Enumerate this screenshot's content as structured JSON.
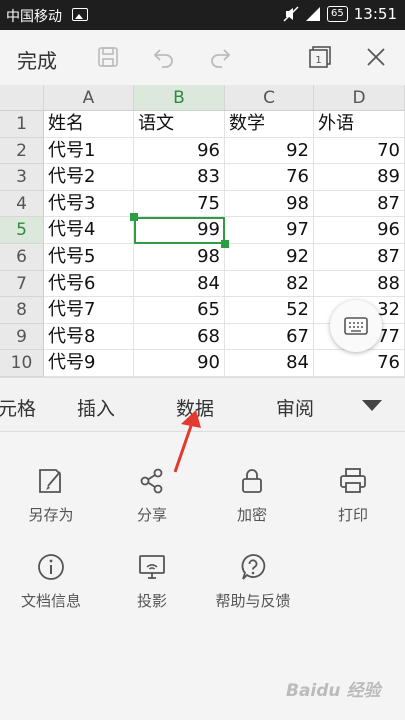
{
  "status": {
    "carrier": "中国移动",
    "battery": "65",
    "time": "13:51"
  },
  "toolbar": {
    "done": "完成"
  },
  "columns": [
    "A",
    "B",
    "C",
    "D"
  ],
  "rows": [
    "1",
    "2",
    "3",
    "4",
    "5",
    "6",
    "7",
    "8",
    "9",
    "10"
  ],
  "table": [
    [
      "姓名",
      "语文",
      "数学",
      "外语"
    ],
    [
      "代号1",
      "96",
      "92",
      "70"
    ],
    [
      "代号2",
      "83",
      "76",
      "89"
    ],
    [
      "代号3",
      "75",
      "98",
      "87"
    ],
    [
      "代号4",
      "99",
      "97",
      "96"
    ],
    [
      "代号5",
      "98",
      "92",
      "87"
    ],
    [
      "代号6",
      "84",
      "82",
      "88"
    ],
    [
      "代号7",
      "65",
      "52",
      "32"
    ],
    [
      "代号8",
      "68",
      "67",
      "77"
    ],
    [
      "代号9",
      "90",
      "84",
      "76"
    ]
  ],
  "tabs": [
    "元格",
    "插入",
    "数据",
    "审阅"
  ],
  "actions": [
    "另存为",
    "分享",
    "加密",
    "打印",
    "文档信息",
    "投影",
    "帮助与反馈"
  ],
  "watermark": "Baidu 经验"
}
